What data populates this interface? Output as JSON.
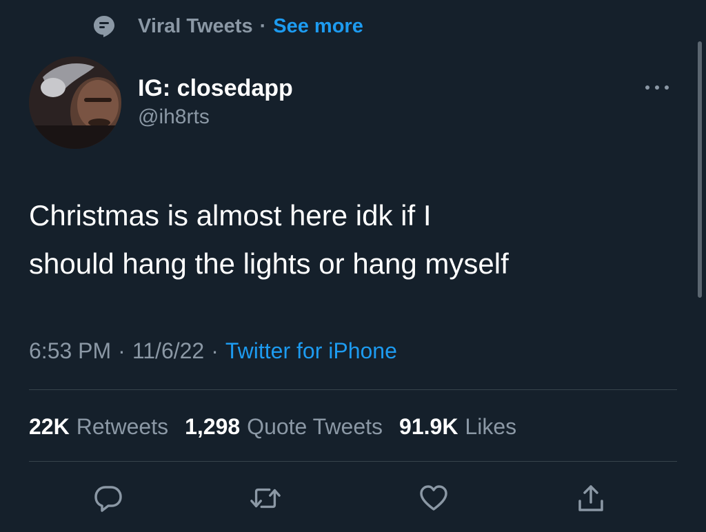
{
  "context": {
    "icon": "topic-bubble-icon",
    "label": "Viral Tweets",
    "separator": "·",
    "see_more": "See more"
  },
  "author": {
    "display_name": "IG: closedapp",
    "handle": "@ih8rts",
    "avatar": "profile-photo"
  },
  "tweet": {
    "lines": [
      "Christmas is almost here idk if I",
      "should hang the lights or hang myself"
    ]
  },
  "meta": {
    "time": "6:53 PM",
    "date": "11/6/22",
    "separator": "·",
    "source": "Twitter for iPhone"
  },
  "stats": {
    "retweets_count": "22K",
    "retweets_label": "Retweets",
    "quotes_count": "1,298",
    "quotes_label": "Quote Tweets",
    "likes_count": "91.9K",
    "likes_label": "Likes"
  },
  "actions": [
    "reply-icon",
    "retweet-icon",
    "like-icon",
    "share-icon"
  ],
  "colors": {
    "background": "#15202b",
    "text": "#ffffff",
    "secondary": "#8b98a5",
    "accent": "#1d9bf0",
    "divider": "#38444d"
  }
}
